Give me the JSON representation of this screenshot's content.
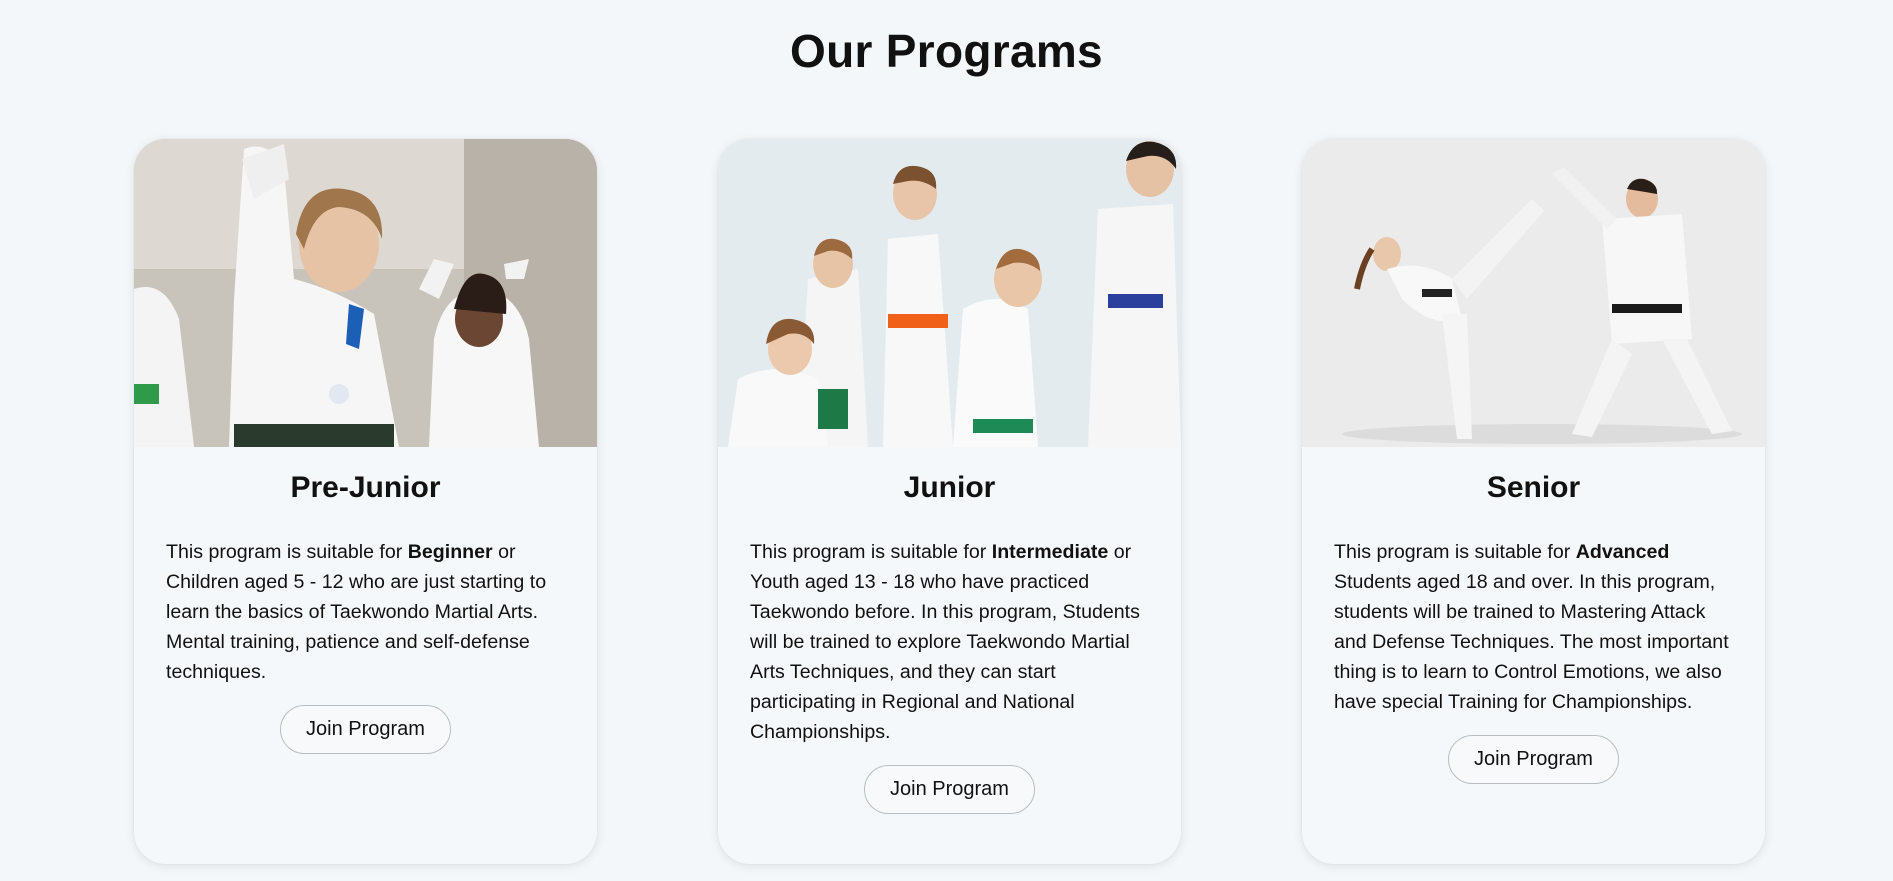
{
  "page": {
    "title": "Our Programs"
  },
  "programs": [
    {
      "title": "Pre-Junior",
      "desc_pre": "This program is suitable for ",
      "desc_bold": "Beginner",
      "desc_post": " or Children aged 5 - 12 who are just starting to learn the basics of Taekwondo Martial Arts. Mental training, patience and self-defense techniques.",
      "button": "Join Program"
    },
    {
      "title": "Junior",
      "desc_pre": "This program is suitable for ",
      "desc_bold": "Intermediate",
      "desc_post": " or Youth aged 13 - 18 who have practiced Taekwondo before. In this program, Students will be trained to explore Taekwondo Martial Arts Techniques, and they can start participating in Regional and National Championships.",
      "button": "Join Program"
    },
    {
      "title": "Senior",
      "desc_pre": "This program is suitable for ",
      "desc_bold": "Advanced",
      "desc_post": " Students aged 18 and over. In this program, students will be trained to Mastering Attack and Defense Techniques. The most important thing is to learn to Control Emotions, we also have special Training for Championships.",
      "button": "Join Program"
    }
  ]
}
